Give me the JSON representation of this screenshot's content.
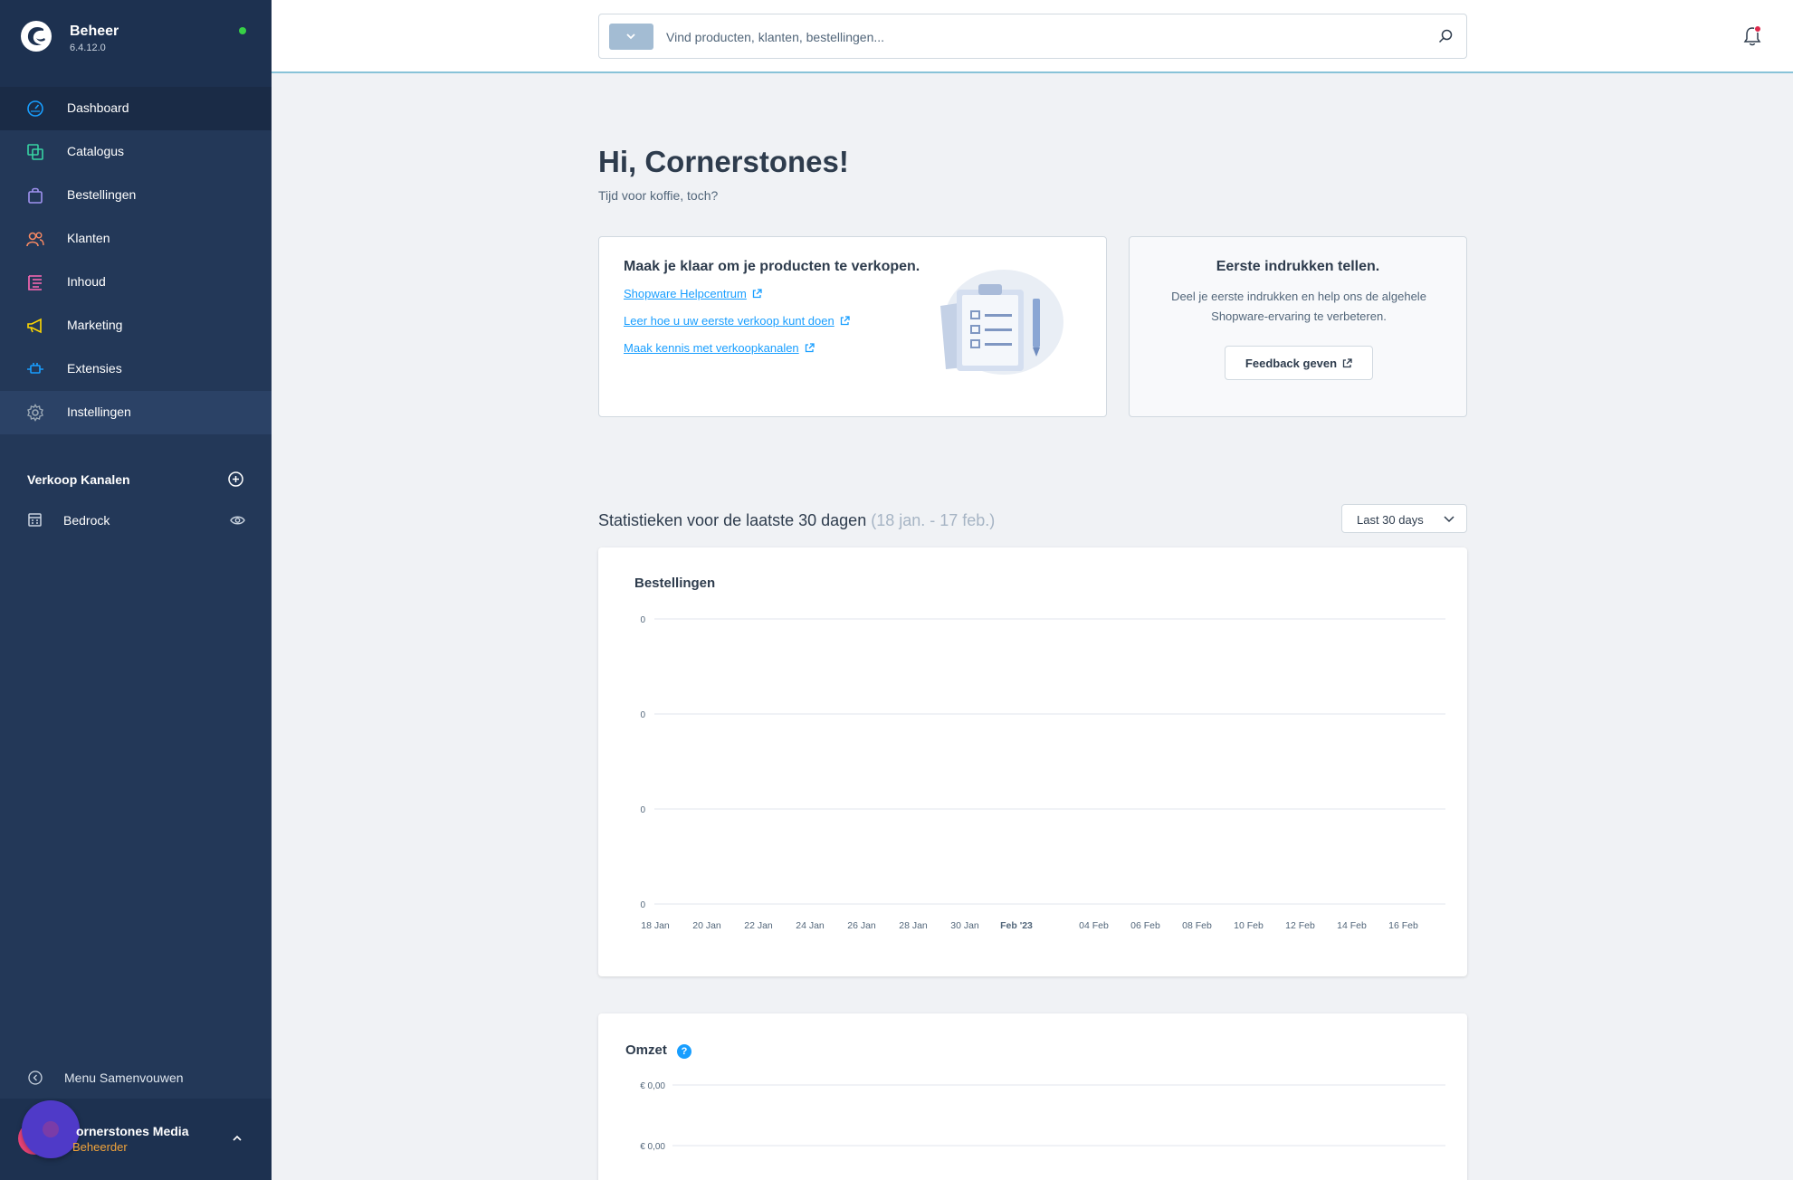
{
  "sidebar": {
    "app_name": "Beheer",
    "version": "6.4.12.0",
    "status_color": "#37d046",
    "nav": [
      {
        "label": "Dashboard",
        "icon": "dashboard-icon",
        "color": "#189eff",
        "active": true
      },
      {
        "label": "Catalogus",
        "icon": "catalog-icon",
        "color": "#37d3a2"
      },
      {
        "label": "Bestellingen",
        "icon": "shopping-bag-icon",
        "color": "#a092f0"
      },
      {
        "label": "Klanten",
        "icon": "customers-icon",
        "color": "#f88962"
      },
      {
        "label": "Inhoud",
        "icon": "content-icon",
        "color": "#ff68b4"
      },
      {
        "label": "Marketing",
        "icon": "megaphone-icon",
        "color": "#ffd700"
      },
      {
        "label": "Extensies",
        "icon": "plugin-icon",
        "color": "#189eff"
      },
      {
        "label": "Instellingen",
        "icon": "gear-icon",
        "color": "#9aa8b5"
      }
    ],
    "channels_title": "Verkoop Kanalen",
    "channels": [
      {
        "label": "Bedrock",
        "icon": "storefront-icon"
      }
    ],
    "collapse_label": "Menu Samenvouwen",
    "user": {
      "name": "Cornerstones Media",
      "name_visible": "ornerstones Media",
      "role": "Beheerder",
      "role_visible": "Beheerder"
    }
  },
  "topbar": {
    "search_placeholder": "Vind producten, klanten, bestellingen..."
  },
  "main": {
    "greeting": "Hi, Cornerstones!",
    "greeting_sub": "Tijd voor koffie, toch?",
    "ready_card": {
      "title": "Maak je klaar om je producten te verkopen.",
      "links": [
        "Shopware Helpcentrum",
        "Leer hoe u uw eerste verkoop kunt doen",
        "Maak kennis met verkoopkanalen"
      ]
    },
    "feedback_card": {
      "title": "Eerste indrukken tellen.",
      "text": "Deel je eerste indrukken en help ons de algehele Shopware-ervaring te verbeteren.",
      "button": "Feedback geven"
    },
    "stats": {
      "title": "Statistieken voor de laatste 30 dagen",
      "range": "(18 jan. - 17 feb.)",
      "select_value": "Last 30 days"
    }
  },
  "chart_data": [
    {
      "type": "line",
      "title": "Bestellingen",
      "x": [
        "18 Jan",
        "20 Jan",
        "22 Jan",
        "24 Jan",
        "26 Jan",
        "28 Jan",
        "30 Jan",
        "Feb '23",
        "04 Feb",
        "06 Feb",
        "08 Feb",
        "10 Feb",
        "12 Feb",
        "14 Feb",
        "16 Feb"
      ],
      "y_ticks": [
        "0",
        "0",
        "0",
        "0"
      ],
      "series": [
        {
          "values": []
        }
      ],
      "grid": true
    },
    {
      "type": "line",
      "title": "Omzet",
      "y_ticks": [
        "€ 0,00",
        "€ 0,00"
      ],
      "series": [
        {
          "values": []
        }
      ],
      "grid": true
    }
  ]
}
